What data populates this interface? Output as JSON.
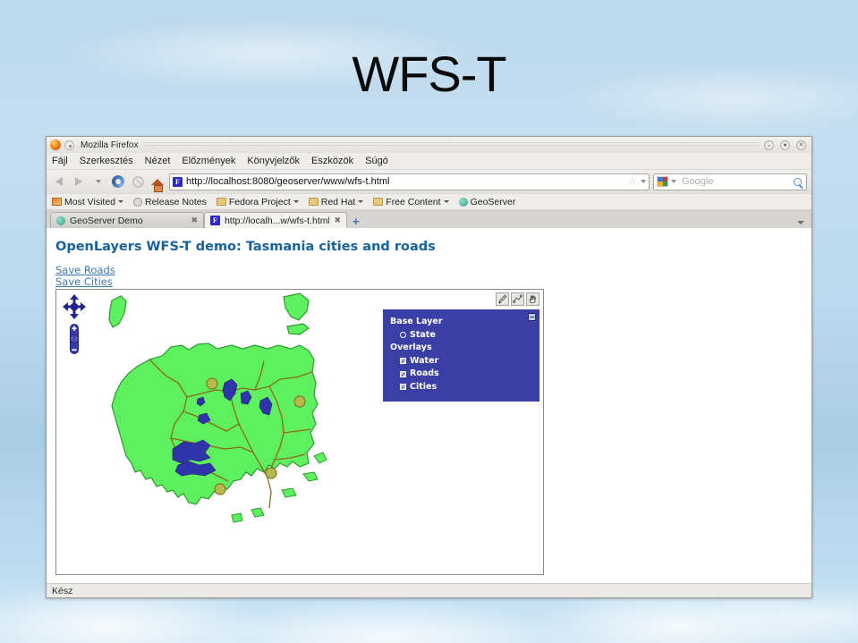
{
  "slide": {
    "title": "WFS-T",
    "background_color": "#bcd8ec"
  },
  "browser": {
    "window_title": "Mozilla Firefox",
    "window_controls": [
      {
        "name": "minimize",
        "glyph": "⌄"
      },
      {
        "name": "maximize",
        "glyph": "●"
      },
      {
        "name": "close",
        "glyph": "✕"
      }
    ],
    "menus": [
      {
        "label": "Fájl",
        "accel": "F"
      },
      {
        "label": "Szerkesztés",
        "accel": "S"
      },
      {
        "label": "Nézet",
        "accel": "N"
      },
      {
        "label": "Előzmények",
        "accel": "z"
      },
      {
        "label": "Könyvjelzők",
        "accel": "K"
      },
      {
        "label": "Eszközök",
        "accel": "E"
      },
      {
        "label": "Súgó",
        "accel": "S"
      }
    ],
    "nav": {
      "back_label": "Back",
      "forward_label": "Forward",
      "reload_label": "Reload",
      "stop_label": "Stop",
      "home_label": "Home"
    },
    "url": "http://localhost:8080/geoserver/www/wfs-t.html",
    "url_favicon": "F",
    "search": {
      "engine": "Google",
      "placeholder": "Google"
    },
    "bookmarks": [
      {
        "label": "Most Visited",
        "icon": "most-visited-icon",
        "has_chevron": true
      },
      {
        "label": "Release Notes",
        "icon": "release-notes-icon",
        "has_chevron": false
      },
      {
        "label": "Fedora Project",
        "icon": "folder-icon",
        "has_chevron": true
      },
      {
        "label": "Red Hat",
        "icon": "folder-icon",
        "has_chevron": true
      },
      {
        "label": "Free Content",
        "icon": "folder-icon",
        "has_chevron": true
      },
      {
        "label": "GeoServer",
        "icon": "geoserver-icon",
        "has_chevron": false
      }
    ],
    "tabs": [
      {
        "label": "GeoServer Demo",
        "active": false,
        "favicon": "geoserver-icon"
      },
      {
        "label": "http://localh...w/wfs-t.html",
        "active": true,
        "favicon": "firefox-page-icon"
      }
    ],
    "new_tab_label": "+",
    "status": "Kész"
  },
  "page": {
    "heading": "OpenLayers WFS-T demo: Tasmania cities and roads",
    "heading_color": "#16619e",
    "links": [
      {
        "label": "Save Roads"
      },
      {
        "label": "Save Cities"
      }
    ],
    "map": {
      "edit_tools": [
        {
          "name": "draw-point-tool",
          "title": "Draw Point"
        },
        {
          "name": "draw-line-tool",
          "title": "Draw Line"
        },
        {
          "name": "pan-tool",
          "title": "Pan"
        }
      ],
      "pan_zoom": {
        "pan_up": "▲",
        "pan_down": "▼",
        "pan_left": "◀",
        "pan_right": "▶",
        "zoom_in": "+",
        "zoom_world": "●",
        "zoom_out": "−"
      },
      "layer_switcher": {
        "minimize_glyph": "−",
        "base_layer_title": "Base Layer",
        "base_layers": [
          {
            "label": "State",
            "selected": true
          }
        ],
        "overlays_title": "Overlays",
        "overlays": [
          {
            "label": "Water",
            "checked": true
          },
          {
            "label": "Roads",
            "checked": true
          },
          {
            "label": "Cities",
            "checked": true
          }
        ],
        "background_color": "#3b3fa5"
      },
      "colors": {
        "land": "#5ef05e",
        "land_outline": "#2c9c2c",
        "road": "#8a6a1e",
        "water": "#2f35a8",
        "city": "#b8b84c",
        "city_outline": "#7a7a28"
      }
    }
  }
}
